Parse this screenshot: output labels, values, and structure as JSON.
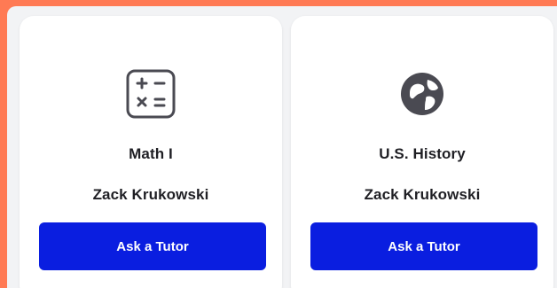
{
  "cards": [
    {
      "icon": "calculator-icon",
      "subject": "Math I",
      "tutor": "Zack Krukowski",
      "button_label": "Ask a Tutor"
    },
    {
      "icon": "globe-icon",
      "subject": "U.S. History",
      "tutor": "Zack Krukowski",
      "button_label": "Ask a Tutor"
    }
  ],
  "colors": {
    "accent": "#0a1ee0",
    "page_border": "#ff7a54",
    "card_bg": "#ffffff",
    "text": "#1f1f24"
  }
}
